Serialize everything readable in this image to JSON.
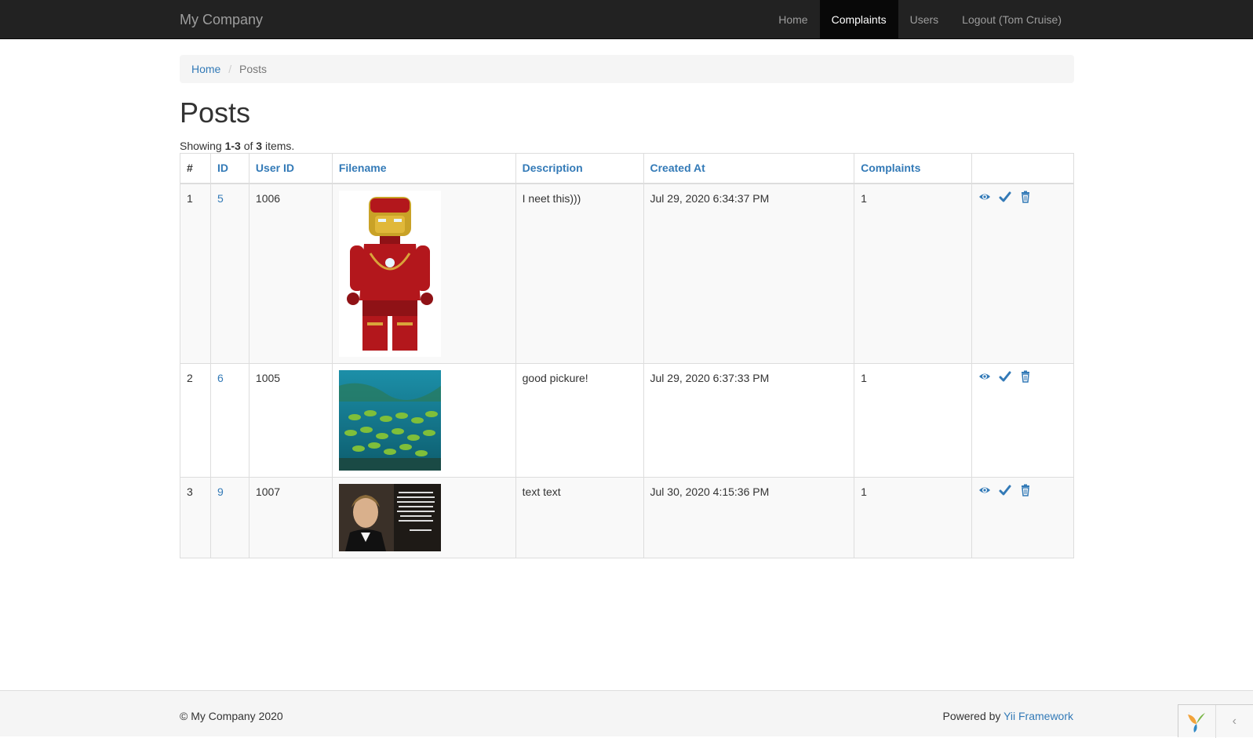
{
  "navbar": {
    "brand": "My Company",
    "items": [
      {
        "label": "Home",
        "active": false
      },
      {
        "label": "Complaints",
        "active": true
      },
      {
        "label": "Users",
        "active": false
      },
      {
        "label": "Logout (Tom Cruise)",
        "active": false
      }
    ]
  },
  "breadcrumb": {
    "home": "Home",
    "separator": "/",
    "current": "Posts"
  },
  "page": {
    "title": "Posts",
    "summary": {
      "prefix": "Showing ",
      "range": "1-3",
      "of": " of ",
      "total": "3",
      "suffix": " items."
    }
  },
  "table": {
    "headers": [
      "#",
      "ID",
      "User ID",
      "Filename",
      "Description",
      "Created At",
      "Complaints",
      ""
    ],
    "rows": [
      {
        "num": "1",
        "id": "5",
        "user_id": "1006",
        "image": "lego-iron-man",
        "description": "I neet this)))",
        "created_at": "Jul 29, 2020 6:34:37 PM",
        "complaints": "1"
      },
      {
        "num": "2",
        "id": "6",
        "user_id": "1005",
        "image": "underwater-fish-school",
        "description": "good pickure!",
        "created_at": "Jul 29, 2020 6:37:33 PM",
        "complaints": "1"
      },
      {
        "num": "3",
        "id": "9",
        "user_id": "1007",
        "image": "man-portrait-with-quote",
        "description": "text text",
        "created_at": "Jul 30, 2020 4:15:36 PM",
        "complaints": "1"
      }
    ],
    "action_icons": [
      "eye-icon",
      "check-icon",
      "trash-icon"
    ]
  },
  "footer": {
    "copyright": "© My Company 2020",
    "powered_prefix": "Powered by ",
    "powered_link": "Yii Framework"
  },
  "colors": {
    "navbar": "#222222",
    "link": "#337ab7",
    "active_nav": "#080808"
  }
}
